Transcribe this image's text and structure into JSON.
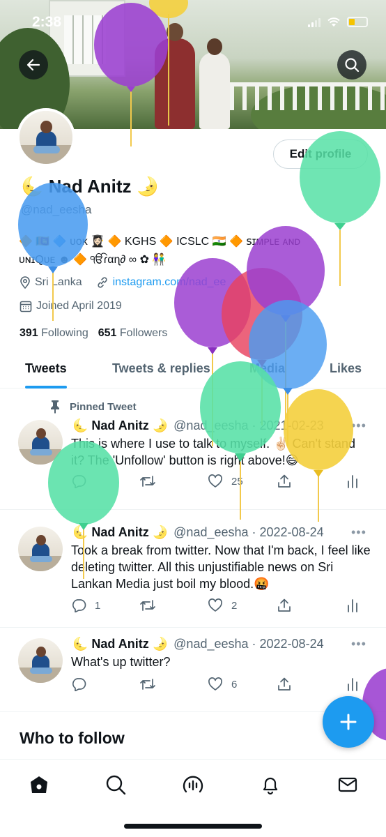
{
  "status_bar": {
    "time": "2:38"
  },
  "profile": {
    "display_name": "🌜 Nad Anitz 🌛",
    "handle": "@nad_eesha",
    "edit_button": "Edit profile",
    "bio_line1": "🔶 🇱🇰 🔷 ᴜᴏᴋ 👩🏻‍🎓 🔶 KGHS 🔶 ICSLC 🇮🇳 🔶 ꜱɪᴍᴘʟᴇ ᴀɴᴅ",
    "bio_line2": "ᴜɴɪQᴜᴇ ☻ 🔶 ੴɾαɳ∂ ∞ ✿ 👫",
    "location": "Sri Lanka",
    "website": "instagram.com/nad_ee",
    "joined": "Joined April 2019",
    "following_count": "391",
    "following_label": "Following",
    "followers_count": "651",
    "followers_label": "Followers"
  },
  "tabs": [
    "Tweets",
    "Tweets & replies",
    "Media",
    "Likes"
  ],
  "pinned_label": "Pinned Tweet",
  "tweets": [
    {
      "name": "🌜 Nad Anitz 🌛",
      "meta": "@nad_eesha · 2021-02-23",
      "text": "This is where I use to talk to myself. ✌🏻 Can't stand it? The 'Unfollow' button is right above!😄",
      "replies": "",
      "retweets": "",
      "likes": "25"
    },
    {
      "name": "🌜 Nad Anitz 🌛",
      "meta": "@nad_eesha · 2022-08-24",
      "text": "Took a break from twitter. Now that I'm back, I feel like deleting twitter. All this unjustifiable news on Sri Lankan Media just boil my blood.🤬",
      "replies": "1",
      "retweets": "",
      "likes": "2"
    },
    {
      "name": "🌜 Nad Anitz 🌛",
      "meta": "@nad_eesha · 2022-08-24",
      "text": "What's up twitter?",
      "replies": "",
      "retweets": "",
      "likes": "6"
    }
  ],
  "who_to_follow": "Who to follow",
  "colors": {
    "accent": "#1d9bf0",
    "text": "#0f1419",
    "muted": "#536471"
  },
  "icons": [
    "back-arrow-icon",
    "search-icon",
    "pin-icon",
    "reply-icon",
    "retweet-icon",
    "like-icon",
    "share-icon",
    "analytics-icon",
    "compose-icon",
    "home-icon",
    "spaces-icon",
    "notifications-icon",
    "messages-icon"
  ]
}
